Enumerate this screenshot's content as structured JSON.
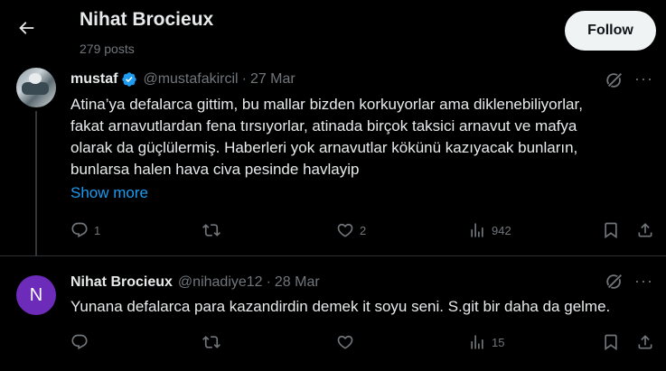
{
  "header": {
    "title": "Nihat Brocieux",
    "posts": "279 posts",
    "follow_label": "Follow"
  },
  "tweets": [
    {
      "name": "mustaf",
      "verified": true,
      "handle": "@mustafakircil",
      "date": "27 Mar",
      "lines": [
        "Atina’ya defalarca gittim, bu mallar bizden korkuyorlar ama diklenebiliyorlar,",
        "fakat arnavutlardan fena tırsıyorlar, atinada birçok taksici arnavut ve mafya",
        "olarak da güçlülermiş. Haberleri yok arnavutlar kökünü kazıyacak bunların,",
        "bunlarsa halen hava civa pesinde havlayip"
      ],
      "show_more": "Show more",
      "replies": "1",
      "retweets": "",
      "likes": "2",
      "views": "942"
    },
    {
      "name": "Nihat Brocieux",
      "avatar_letter": "N",
      "handle": "@nihadiye12",
      "date": "28 Mar",
      "text": "Yunana defalarca para kazandirdin demek it soyu seni. S.git bir daha da gelme.",
      "replies": "",
      "retweets": "",
      "likes": "",
      "views": "15"
    }
  ],
  "ui": {
    "dot": "·",
    "more": "···"
  },
  "colors": {
    "background": "#000000",
    "text": "#e7e9ea",
    "muted": "#71767b",
    "link": "#1d9bf0",
    "verified": "#1d9bf0",
    "avatar_n": "#6c2bb9"
  },
  "icons": [
    "back-arrow-icon",
    "verified-badge-icon",
    "grok-icon",
    "more-icon",
    "reply-icon",
    "retweet-icon",
    "like-icon",
    "views-icon",
    "bookmark-icon",
    "share-icon"
  ]
}
